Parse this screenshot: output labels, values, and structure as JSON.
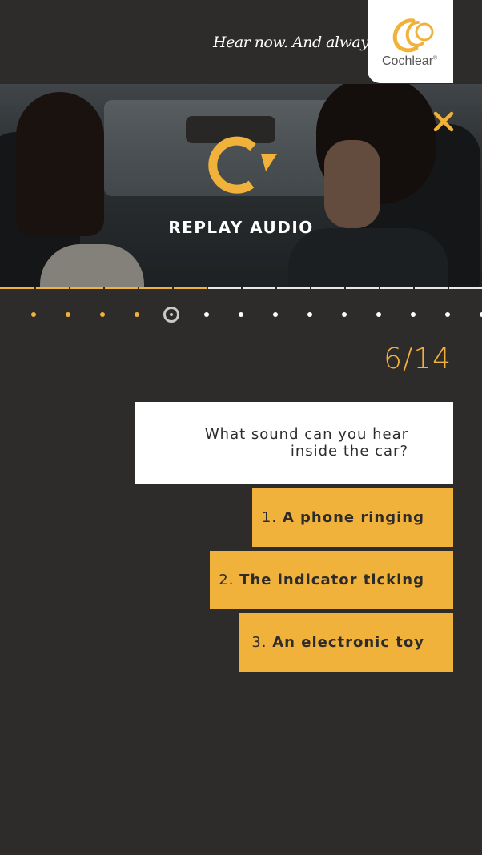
{
  "header": {
    "tagline": "Hear now. And always",
    "logo_text": "Cochlear",
    "logo_mark": "®"
  },
  "video": {
    "replay_label": "REPLAY AUDIO",
    "progress_fraction": 0.43
  },
  "close_icon": "close-icon",
  "replay_icon": "replay-icon",
  "pagination": {
    "total": 14,
    "current": 5,
    "completed": 4
  },
  "counter": "6/14",
  "question": {
    "line1": "What sound can you hear",
    "line2": "inside the car?"
  },
  "answers": [
    {
      "number": "1.",
      "text": "A phone ringing"
    },
    {
      "number": "2.",
      "text": "The indicator ticking"
    },
    {
      "number": "3.",
      "text": "An electronic toy"
    }
  ],
  "colors": {
    "accent": "#f0b23a",
    "background": "#2d2c2b",
    "white": "#ffffff"
  }
}
